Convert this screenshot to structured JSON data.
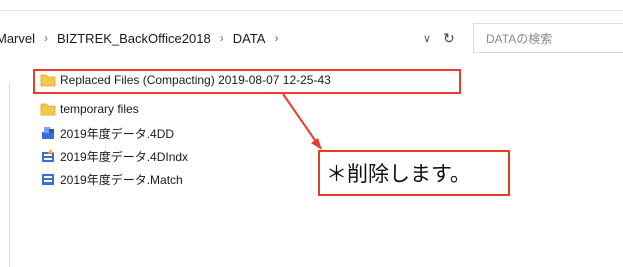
{
  "breadcrumb": {
    "items": [
      "Marvel",
      "BIZTREK_BackOffice2018",
      "DATA"
    ],
    "separator": "›"
  },
  "search": {
    "placeholder": "DATAの検索"
  },
  "files": [
    {
      "name": "Replaced Files (Compacting) 2019-08-07 12-25-43",
      "icon": "folder-icon"
    },
    {
      "name": "temporary files",
      "icon": "folder-icon"
    },
    {
      "name": "2019年度データ.4DD",
      "icon": "4d-data-file-icon"
    },
    {
      "name": "2019年度データ.4DIndx",
      "icon": "4d-index-file-icon"
    },
    {
      "name": "2019年度データ.Match",
      "icon": "4d-match-file-icon"
    }
  ],
  "annotation": {
    "text": "＊削除します。"
  },
  "colors": {
    "highlight": "#ee3b2b",
    "folder": "#f4c84a",
    "file_icon": "#3b6fcf"
  }
}
